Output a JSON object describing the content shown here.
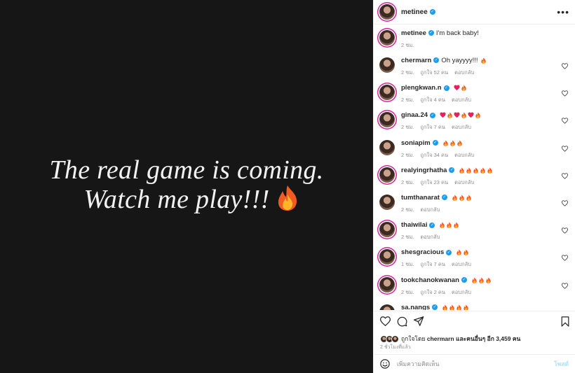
{
  "post": {
    "quote_line1": "The real game is coming.",
    "quote_line2": "Watch me play!!!",
    "quote_emoji": "fire"
  },
  "header": {
    "username": "metinee",
    "more_label": "•••"
  },
  "caption": {
    "username": "metinee",
    "text": "I'm back baby!",
    "time": "2 ชม."
  },
  "comments": [
    {
      "username": "chermarn",
      "text": "Oh yayyyy!!!",
      "emoji": [
        "fire"
      ],
      "time": "2 ชม.",
      "likes": "ถูกใจ 52 คน",
      "reply": "ตอบกลับ"
    },
    {
      "username": "plengkwan.n",
      "text": "",
      "emoji": [
        "heart",
        "fire"
      ],
      "time": "2 ชม.",
      "likes": "ถูกใจ 4 คน",
      "reply": "ตอบกลับ"
    },
    {
      "username": "ginaa.24",
      "text": "",
      "emoji": [
        "heart",
        "fire",
        "heart",
        "fire",
        "heart",
        "fire"
      ],
      "time": "2 ชม.",
      "likes": "ถูกใจ 7 คน",
      "reply": "ตอบกลับ"
    },
    {
      "username": "soniapim",
      "text": "",
      "emoji": [
        "fire",
        "fire",
        "fire"
      ],
      "time": "2 ชม.",
      "likes": "ถูกใจ 34 คน",
      "reply": "ตอบกลับ"
    },
    {
      "username": "realyingrhatha",
      "text": "",
      "emoji": [
        "fire",
        "fire",
        "fire",
        "fire",
        "fire"
      ],
      "time": "2 ชม.",
      "likes": "ถูกใจ 23 คน",
      "reply": "ตอบกลับ"
    },
    {
      "username": "tumthanarat",
      "text": "",
      "emoji": [
        "fire",
        "fire",
        "fire"
      ],
      "time": "2 ชม.",
      "likes": "",
      "reply": "ตอบกลับ"
    },
    {
      "username": "thaiwilai",
      "text": "",
      "emoji": [
        "fire",
        "fire",
        "fire"
      ],
      "time": "2 ชม.",
      "likes": "",
      "reply": "ตอบกลับ"
    },
    {
      "username": "shesgracious",
      "text": "",
      "emoji": [
        "fire",
        "fire"
      ],
      "time": "1 ชม.",
      "likes": "ถูกใจ 7 คน",
      "reply": "ตอบกลับ"
    },
    {
      "username": "tookchanokwanan",
      "text": "",
      "emoji": [
        "fire",
        "fire",
        "fire"
      ],
      "time": "2 ชม.",
      "likes": "ถูกใจ 2 คน",
      "reply": "ตอบกลับ"
    },
    {
      "username": "sa.nangs",
      "text": "",
      "emoji": [
        "fire",
        "fire",
        "fire",
        "fire"
      ],
      "time": "",
      "likes": "",
      "reply": ""
    }
  ],
  "actions": {
    "icons": [
      "heart-icon",
      "comment-icon",
      "share-icon",
      "bookmark-icon"
    ]
  },
  "likes": {
    "prefix": "ถูกใจโดย",
    "user": "chermarn",
    "suffix": "และคนอื่นๆ อีก 3,459 คน"
  },
  "time_ago": "2 ชั่วโมงที่แล้ว",
  "composer": {
    "placeholder": "เพิ่มความคิดเห็น",
    "post_label": "โพสต์"
  },
  "colors": {
    "image_bg": "#161616",
    "verified": "#1d9bf0",
    "post_button": "#b2dffc",
    "muted_text": "#8e8e8e"
  }
}
